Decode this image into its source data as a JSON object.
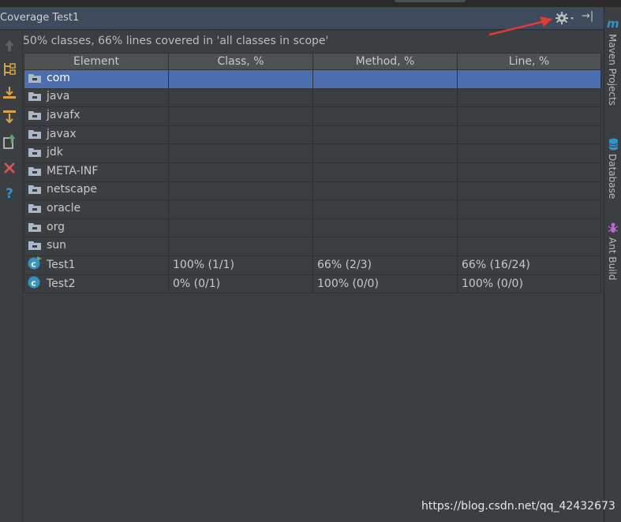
{
  "window": {
    "title": "Coverage Test1"
  },
  "summary": "50% classes, 66% lines covered in 'all classes in scope'",
  "table": {
    "headers": [
      "Element",
      "Class, %",
      "Method, %",
      "Line, %"
    ],
    "rows": [
      {
        "name": "com",
        "icon": "package-folder-icon",
        "class": "",
        "method": "",
        "line": "",
        "selected": true
      },
      {
        "name": "java",
        "icon": "package-folder-icon",
        "class": "",
        "method": "",
        "line": ""
      },
      {
        "name": "javafx",
        "icon": "package-folder-icon",
        "class": "",
        "method": "",
        "line": ""
      },
      {
        "name": "javax",
        "icon": "package-folder-icon",
        "class": "",
        "method": "",
        "line": ""
      },
      {
        "name": "jdk",
        "icon": "package-folder-icon",
        "class": "",
        "method": "",
        "line": ""
      },
      {
        "name": "META-INF",
        "icon": "package-folder-icon",
        "class": "",
        "method": "",
        "line": ""
      },
      {
        "name": "netscape",
        "icon": "package-folder-icon",
        "class": "",
        "method": "",
        "line": ""
      },
      {
        "name": "oracle",
        "icon": "package-folder-icon",
        "class": "",
        "method": "",
        "line": ""
      },
      {
        "name": "org",
        "icon": "package-folder-icon",
        "class": "",
        "method": "",
        "line": ""
      },
      {
        "name": "sun",
        "icon": "package-folder-icon",
        "class": "",
        "method": "",
        "line": ""
      },
      {
        "name": "Test1",
        "icon": "class-run-icon",
        "class": "100% (1/1)",
        "method": "66% (2/3)",
        "line": "66% (16/24)"
      },
      {
        "name": "Test2",
        "icon": "class-icon",
        "class": "0% (0/1)",
        "method": "100% (0/0)",
        "line": "100% (0/0)"
      }
    ]
  },
  "right_sidebar": {
    "maven": "Maven Projects",
    "database": "Database",
    "ant": "Ant Build"
  },
  "left_toolbar": [
    "up-arrow-icon",
    "tree-view-icon",
    "import-icon",
    "flatten-icon",
    "export-icon",
    "close-icon",
    "help-icon"
  ],
  "header_icons": [
    "gear-icon",
    "hide-icon"
  ],
  "watermark": "https://blog.csdn.net/qq_42432673",
  "colors": {
    "header": "#3d4b5c",
    "selection": "#4b6eaf",
    "panel": "#3c3f41",
    "annotation_arrow": "#e53935"
  }
}
